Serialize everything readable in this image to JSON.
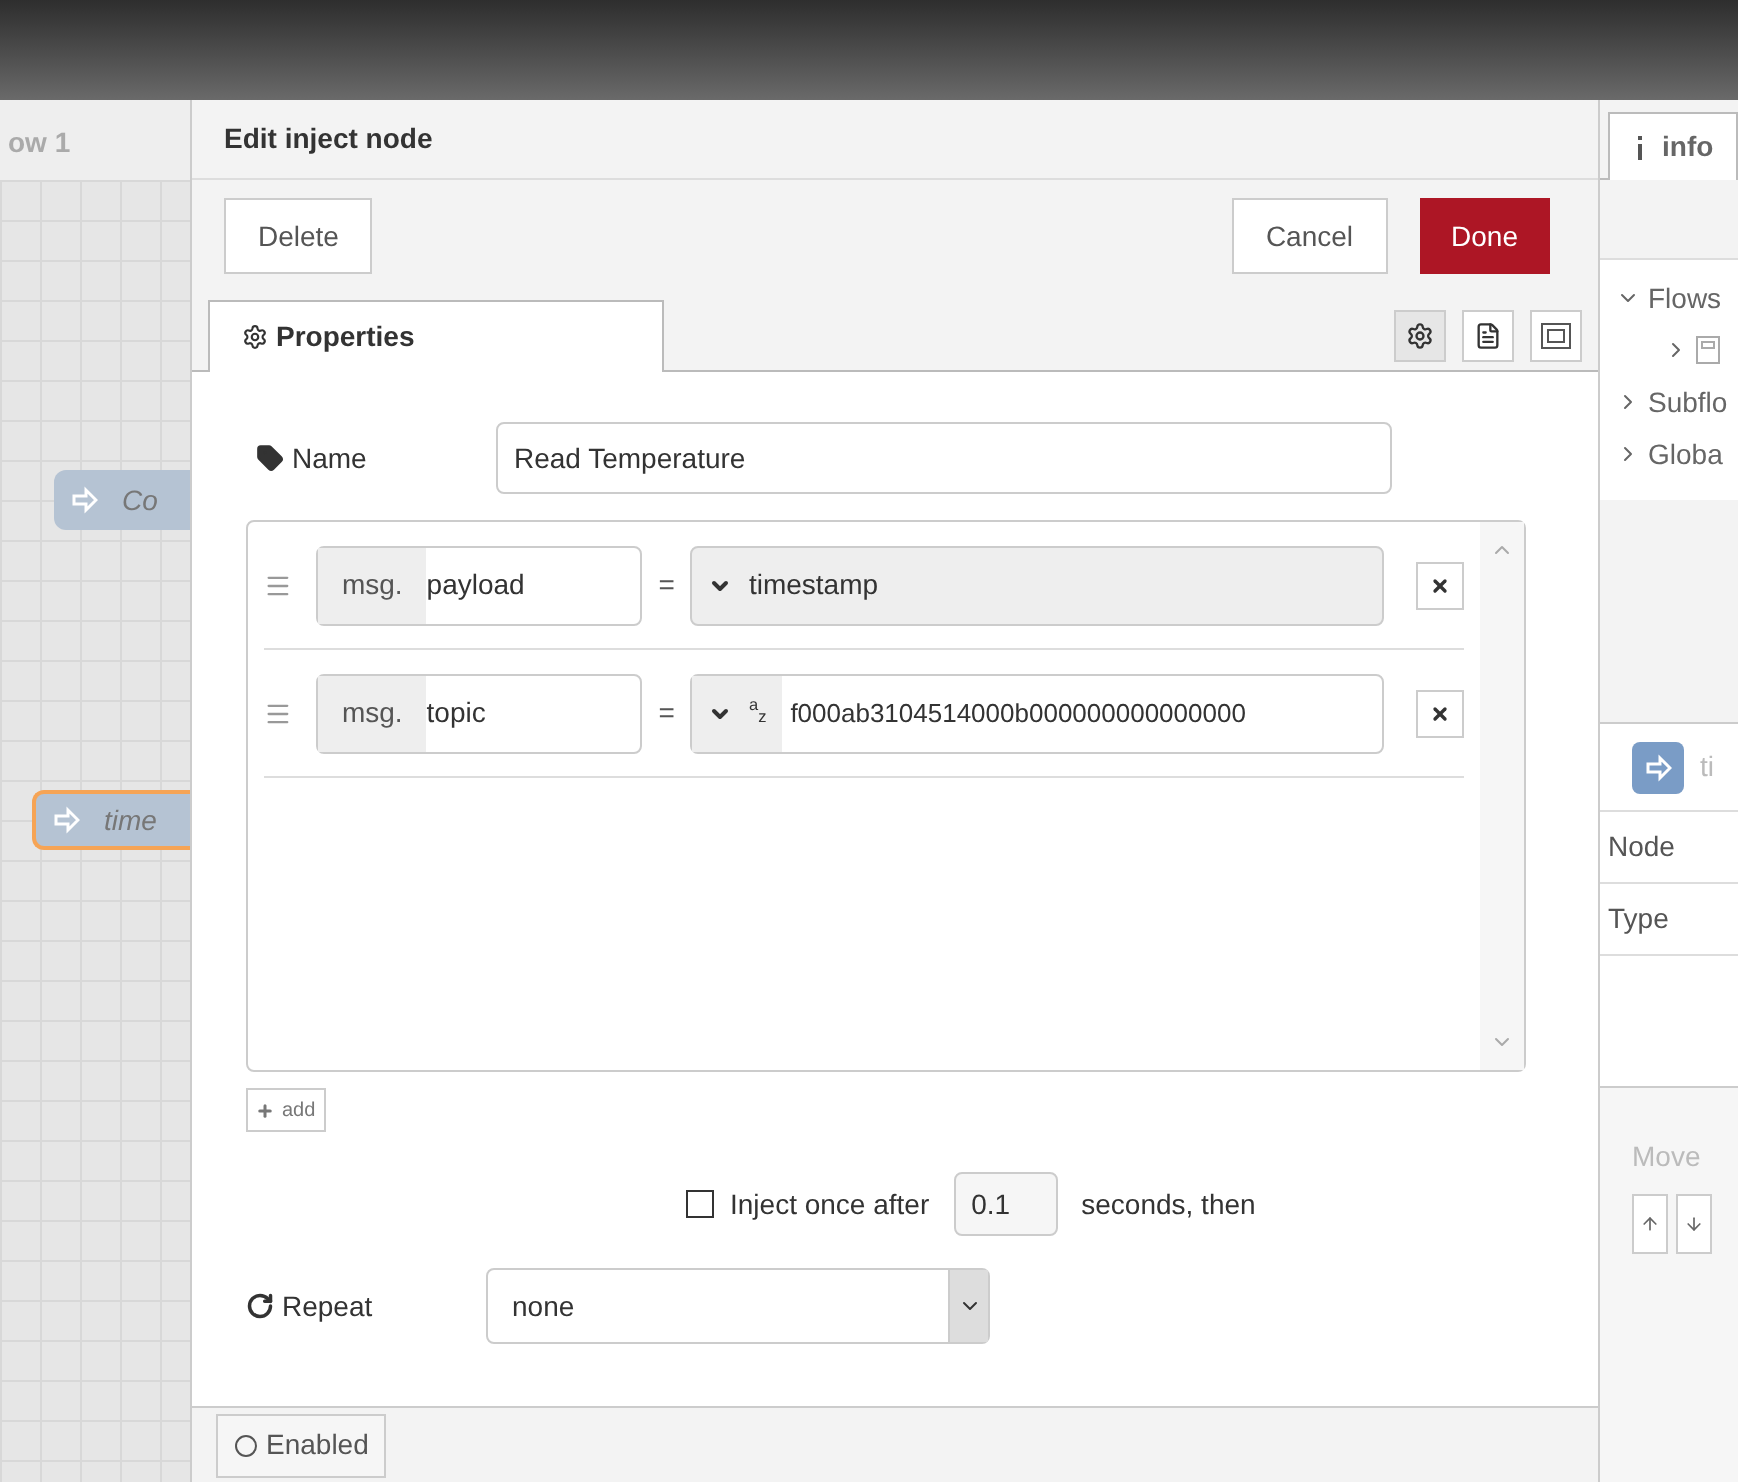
{
  "canvas": {
    "tab_label": "ow 1",
    "nodes": [
      {
        "label": "Co",
        "selected": false
      },
      {
        "label": "time",
        "selected": true
      }
    ]
  },
  "dialog": {
    "title": "Edit inject node",
    "buttons": {
      "delete": "Delete",
      "cancel": "Cancel",
      "done": "Done"
    },
    "tab": {
      "label": "Properties",
      "selected": true
    },
    "name": {
      "label": "Name",
      "value": "Read Temperature"
    },
    "properties": [
      {
        "prefix": "msg.",
        "field": "payload",
        "equals": "=",
        "kind": "timestamp",
        "value": "timestamp"
      },
      {
        "prefix": "msg.",
        "field": "topic",
        "equals": "=",
        "kind": "string",
        "type_glyph": "$^{a}$$_{z}$",
        "value": "f000ab3104514000b000000000000000"
      }
    ],
    "add_button": "add",
    "inject_once": {
      "checked": false,
      "label": "Inject once after",
      "value": "0.1",
      "suffix": "seconds, then"
    },
    "repeat": {
      "label": "Repeat",
      "value": "none"
    },
    "enabled": {
      "label": "Enabled"
    }
  },
  "sidebar": {
    "tab": "info",
    "tree": [
      {
        "label": "Flows",
        "expanded": true,
        "children": [
          {
            "expanded": false
          }
        ]
      },
      {
        "label": "Subflo",
        "expanded": false
      },
      {
        "label": "Globa",
        "expanded": false
      }
    ],
    "node_title": "ti",
    "rows": [
      "Node",
      "Type"
    ],
    "move_label": "Move"
  }
}
